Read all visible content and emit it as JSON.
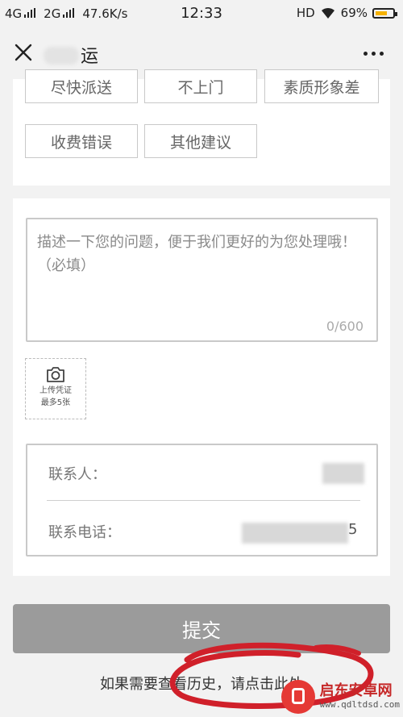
{
  "status_bar": {
    "net1": "4G",
    "net2": "2G",
    "speed": "47.6K/s",
    "time": "12:33",
    "hd": "HD",
    "battery": "69%",
    "battery_level": 0.69
  },
  "header": {
    "title": "运",
    "close_icon": "close-icon",
    "more_icon": "more-dots-icon"
  },
  "tags": [
    "尽快派送",
    "不上门",
    "素质形象差",
    "收费错误",
    "其他建议"
  ],
  "description": {
    "placeholder": "描述一下您的问题，便于我们更好的为您处理哦！（必填）",
    "counter": "0/600"
  },
  "upload": {
    "icon": "camera-icon",
    "line1": "上传凭证",
    "line2": "最多5张"
  },
  "contact": {
    "name_label": "联系人：",
    "phone_label": "联系电话：",
    "phone_tail": "5"
  },
  "submit_label": "提交",
  "history_text": "如果需要查看历史，请点击此处",
  "watermark": {
    "name": "启东安卓网",
    "url": "www.qdltdsd.com"
  },
  "colors": {
    "background": "#f2f2f2",
    "card": "#ffffff",
    "submit": "#9b9b9b",
    "annotation": "#d0202a",
    "battery": "#f5b100"
  }
}
